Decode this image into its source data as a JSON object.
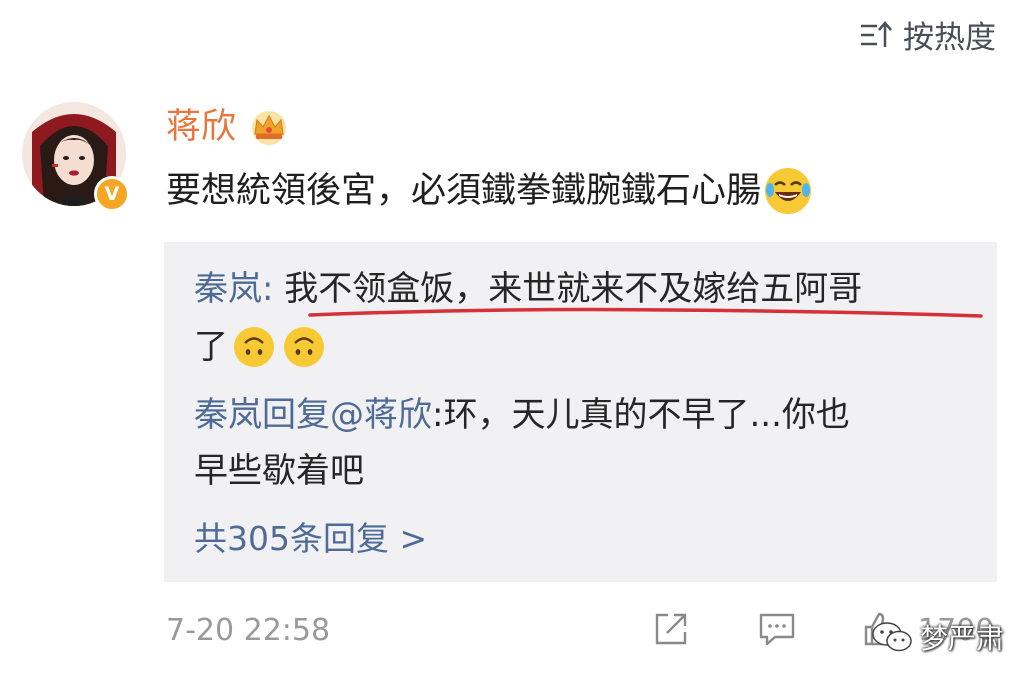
{
  "sort": {
    "label": "按热度",
    "icon": "sort-icon"
  },
  "comment": {
    "author": "蒋欣",
    "author_color": "#e8753c",
    "badge_icon": "crown-icon",
    "verified_mark": "V",
    "text": "要想統領後宮，必須鐵拳鐵腕鐵石心腸",
    "emoji": "laughing-tears-emoji",
    "time": "7-20 22:58",
    "like_count": "1700"
  },
  "replies": [
    {
      "user": "秦岚",
      "separator": ": ",
      "text_line1": "我不领盒饭，来世就来不及嫁给五阿哥",
      "text_line2": "了",
      "emojis": [
        "upside-down-face-emoji",
        "upside-down-face-emoji"
      ]
    },
    {
      "user_prefix": "秦岚回复@蒋欣",
      "text_line1": ":环，天儿真的不早了...你也",
      "text_line2": "早些歇着吧"
    }
  ],
  "more_replies": "共305条回复 >",
  "watermark": {
    "text": "梦严肃",
    "icon": "wechat-icon"
  },
  "colors": {
    "link": "#4d6b96",
    "reply_bg": "#f1f1f3",
    "underline": "#d6313a",
    "muted": "#9a9a9a"
  }
}
